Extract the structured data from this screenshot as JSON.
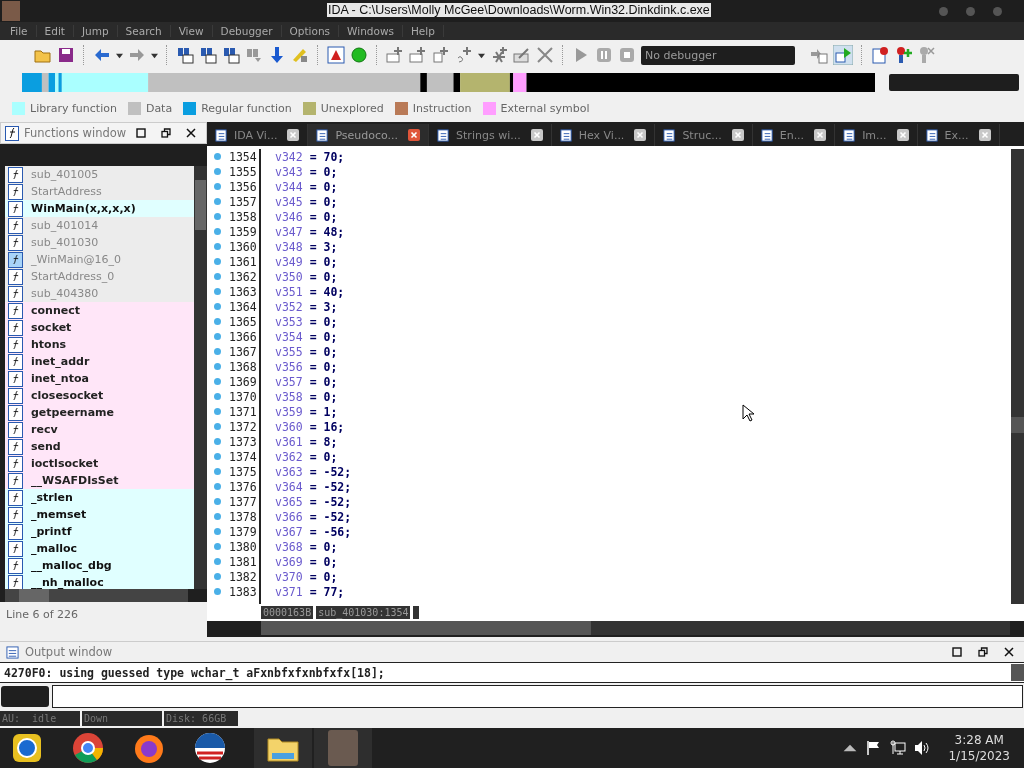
{
  "window": {
    "title": "IDA - C:\\Users\\Molly McGee\\Downloads\\Worm.Win32.Dinkdink.c.exe"
  },
  "menu": [
    "File",
    "Edit",
    "Jump",
    "Search",
    "View",
    "Debugger",
    "Options",
    "Windows",
    "Help"
  ],
  "toolbar": {
    "debugger_select": "No debugger"
  },
  "legend": [
    {
      "label": "Library function",
      "color": "#aaffff"
    },
    {
      "label": "Data",
      "color": "#c0c0c0"
    },
    {
      "label": "Regular function",
      "color": "#0a9ee0"
    },
    {
      "label": "Unexplored",
      "color": "#b4b46e"
    },
    {
      "label": "Instruction",
      "color": "#b97a57"
    },
    {
      "label": "External symbol",
      "color": "#ff9eff"
    }
  ],
  "functions_window": {
    "title": "Functions window",
    "status": "Line 6 of 226",
    "items": [
      {
        "name": "sub_401005",
        "kind": "regular",
        "selected": false
      },
      {
        "name": "StartAddress",
        "kind": "regular",
        "selected": false
      },
      {
        "name": "WinMain(x,x,x,x)",
        "kind": "library",
        "selected": false
      },
      {
        "name": "sub_401014",
        "kind": "regular",
        "selected": false
      },
      {
        "name": "sub_401030",
        "kind": "regular",
        "selected": false
      },
      {
        "name": "_WinMain@16_0",
        "kind": "regular",
        "selected": true
      },
      {
        "name": "StartAddress_0",
        "kind": "regular",
        "selected": false
      },
      {
        "name": "sub_404380",
        "kind": "regular",
        "selected": false
      },
      {
        "name": "connect",
        "kind": "external",
        "selected": false
      },
      {
        "name": "socket",
        "kind": "external",
        "selected": false
      },
      {
        "name": "htons",
        "kind": "external",
        "selected": false
      },
      {
        "name": "inet_addr",
        "kind": "external",
        "selected": false
      },
      {
        "name": "inet_ntoa",
        "kind": "external",
        "selected": false
      },
      {
        "name": "closesocket",
        "kind": "external",
        "selected": false
      },
      {
        "name": "getpeername",
        "kind": "external",
        "selected": false
      },
      {
        "name": "recv",
        "kind": "external",
        "selected": false
      },
      {
        "name": "send",
        "kind": "external",
        "selected": false
      },
      {
        "name": "ioctlsocket",
        "kind": "external",
        "selected": false
      },
      {
        "name": "__WSAFDIsSet",
        "kind": "external",
        "selected": false
      },
      {
        "name": "_strlen",
        "kind": "library",
        "selected": false
      },
      {
        "name": "_memset",
        "kind": "library",
        "selected": false
      },
      {
        "name": "_printf",
        "kind": "library",
        "selected": false
      },
      {
        "name": "_malloc",
        "kind": "library",
        "selected": false
      },
      {
        "name": "__malloc_dbg",
        "kind": "library",
        "selected": false
      },
      {
        "name": "__nh_malloc",
        "kind": "library",
        "selected": false
      }
    ]
  },
  "tabs": [
    {
      "label": "IDA Vi...",
      "selected": false
    },
    {
      "label": "Pseudoco...",
      "selected": true
    },
    {
      "label": "Strings wi...",
      "selected": false
    },
    {
      "label": "Hex Vi...",
      "selected": false
    },
    {
      "label": "Struc...",
      "selected": false
    },
    {
      "label": "En...",
      "selected": false
    },
    {
      "label": "Im...",
      "selected": false
    },
    {
      "label": "Ex...",
      "selected": false
    }
  ],
  "code": {
    "lines": [
      {
        "number": "1354",
        "text": "v342 = 70;"
      },
      {
        "number": "1355",
        "text": "v343 = 0;"
      },
      {
        "number": "1356",
        "text": "v344 = 0;"
      },
      {
        "number": "1357",
        "text": "v345 = 0;"
      },
      {
        "number": "1358",
        "text": "v346 = 0;"
      },
      {
        "number": "1359",
        "text": "v347 = 48;"
      },
      {
        "number": "1360",
        "text": "v348 = 3;"
      },
      {
        "number": "1361",
        "text": "v349 = 0;"
      },
      {
        "number": "1362",
        "text": "v350 = 0;"
      },
      {
        "number": "1363",
        "text": "v351 = 40;"
      },
      {
        "number": "1364",
        "text": "v352 = 3;"
      },
      {
        "number": "1365",
        "text": "v353 = 0;"
      },
      {
        "number": "1366",
        "text": "v354 = 0;"
      },
      {
        "number": "1367",
        "text": "v355 = 0;"
      },
      {
        "number": "1368",
        "text": "v356 = 0;"
      },
      {
        "number": "1369",
        "text": "v357 = 0;"
      },
      {
        "number": "1370",
        "text": "v358 = 0;"
      },
      {
        "number": "1371",
        "text": "v359 = 1;"
      },
      {
        "number": "1372",
        "text": "v360 = 16;"
      },
      {
        "number": "1373",
        "text": "v361 = 8;"
      },
      {
        "number": "1374",
        "text": "v362 = 0;"
      },
      {
        "number": "1375",
        "text": "v363 = -52;"
      },
      {
        "number": "1376",
        "text": "v364 = -52;"
      },
      {
        "number": "1377",
        "text": "v365 = -52;"
      },
      {
        "number": "1378",
        "text": "v366 = -52;"
      },
      {
        "number": "1379",
        "text": "v367 = -56;"
      },
      {
        "number": "1380",
        "text": "v368 = 0;"
      },
      {
        "number": "1381",
        "text": "v369 = 0;"
      },
      {
        "number": "1382",
        "text": "v370 = 0;"
      },
      {
        "number": "1383",
        "text": "v371 = 77;"
      }
    ],
    "address": "0000163B",
    "location": "sub_401030:1354"
  },
  "output_window": {
    "title": "Output window",
    "line": "4270F0: using guessed type wchar_t aFxnbfxfxnbfxfx[18];"
  },
  "status_bar": [
    "AU:  idle",
    "Down",
    "Disk: 66GB"
  ],
  "taskbar": {
    "time": "3:28 AM",
    "date": "1/15/2023"
  }
}
